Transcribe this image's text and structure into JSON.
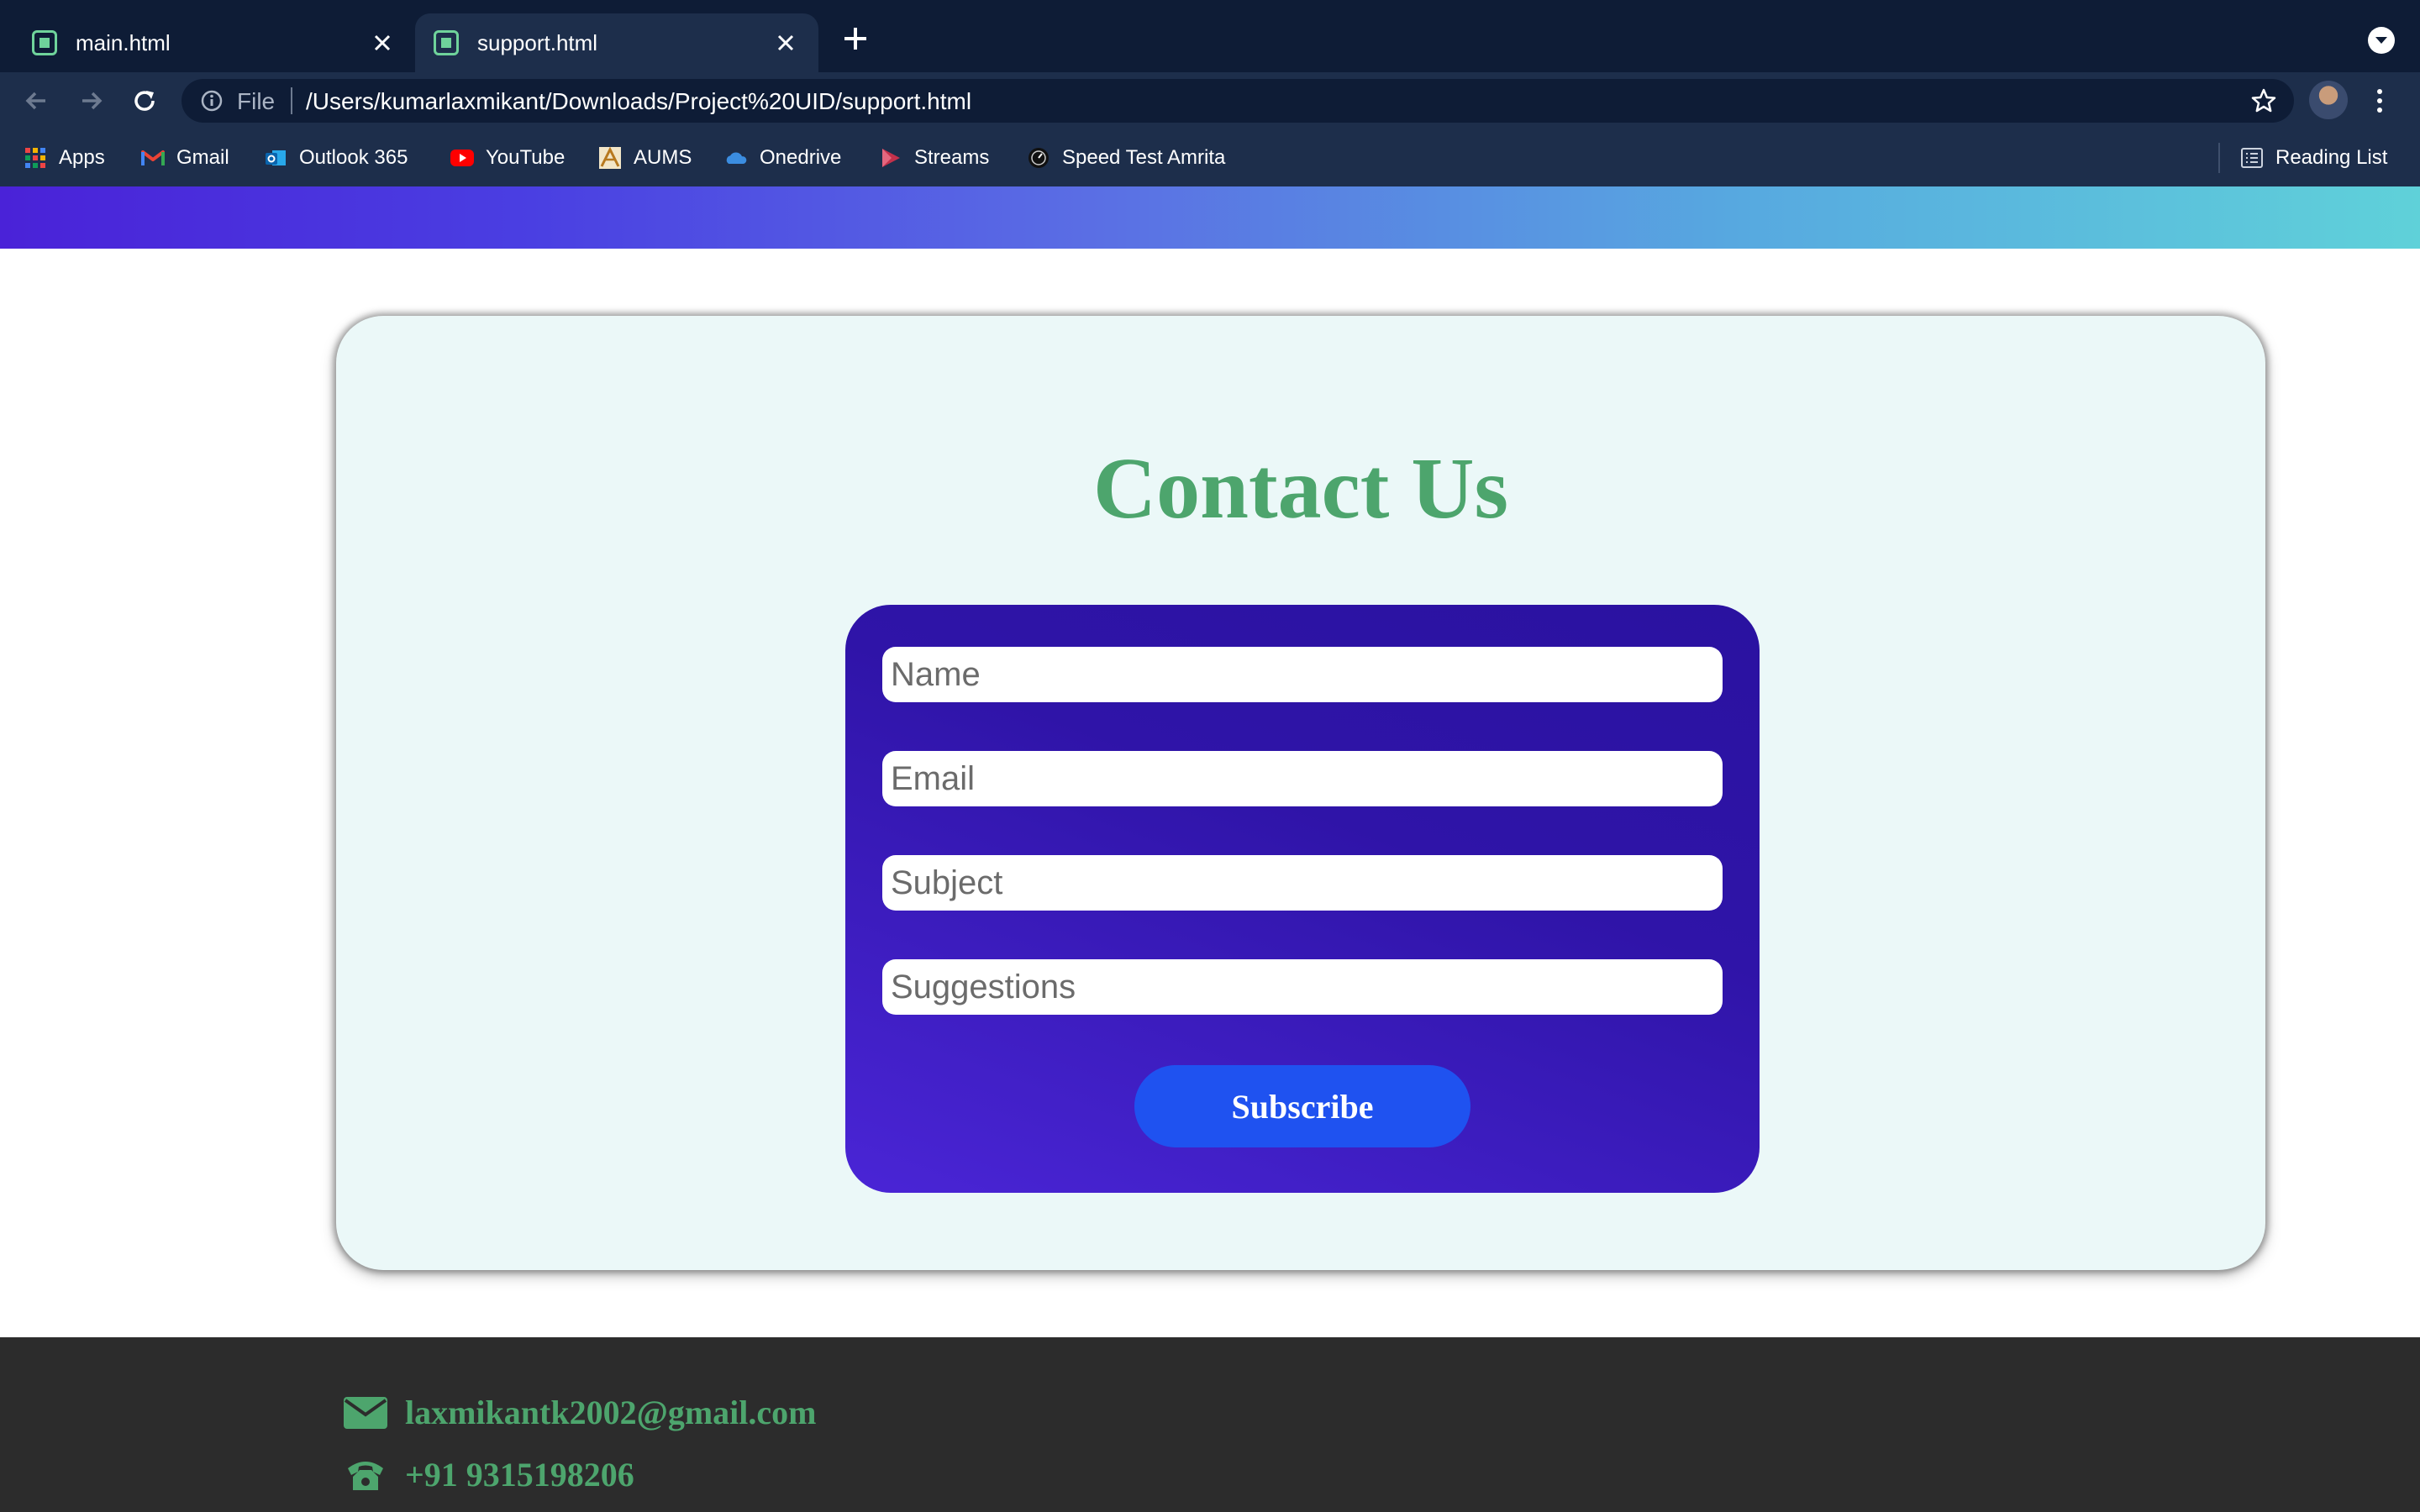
{
  "tabs": [
    {
      "label": "main.html",
      "active": false
    },
    {
      "label": "support.html",
      "active": true
    }
  ],
  "address_bar": {
    "scheme_label": "File",
    "url": "/Users/kumarlaxmikant/Downloads/Project%20UID/support.html"
  },
  "bookmarks": [
    {
      "label": "Apps",
      "icon": "apps-grid-icon"
    },
    {
      "label": "Gmail",
      "icon": "gmail-icon"
    },
    {
      "label": "Outlook 365",
      "icon": "outlook-icon"
    },
    {
      "label": "YouTube",
      "icon": "youtube-icon"
    },
    {
      "label": "AUMS",
      "icon": "aums-icon"
    },
    {
      "label": "Onedrive",
      "icon": "onedrive-icon"
    },
    {
      "label": "Streams",
      "icon": "streams-icon"
    },
    {
      "label": "Speed Test Amrita",
      "icon": "speedtest-icon"
    }
  ],
  "reading_list": {
    "label": "Reading List",
    "icon": "reading-list-icon"
  },
  "contact": {
    "title": "Contact Us",
    "fields": {
      "name_placeholder": "Name",
      "email_placeholder": "Email",
      "subject_placeholder": "Subject",
      "suggestions_placeholder": "Suggestions"
    },
    "submit_label": "Subscribe"
  },
  "footer": {
    "email": "laxmikantk2002@gmail.com",
    "phone": "+91 9315198206"
  },
  "colors": {
    "accent_green": "#4da56d",
    "form_purple": "#2f14a8",
    "button_blue": "#1f52f0",
    "footer_bg": "#2c2c2c"
  }
}
